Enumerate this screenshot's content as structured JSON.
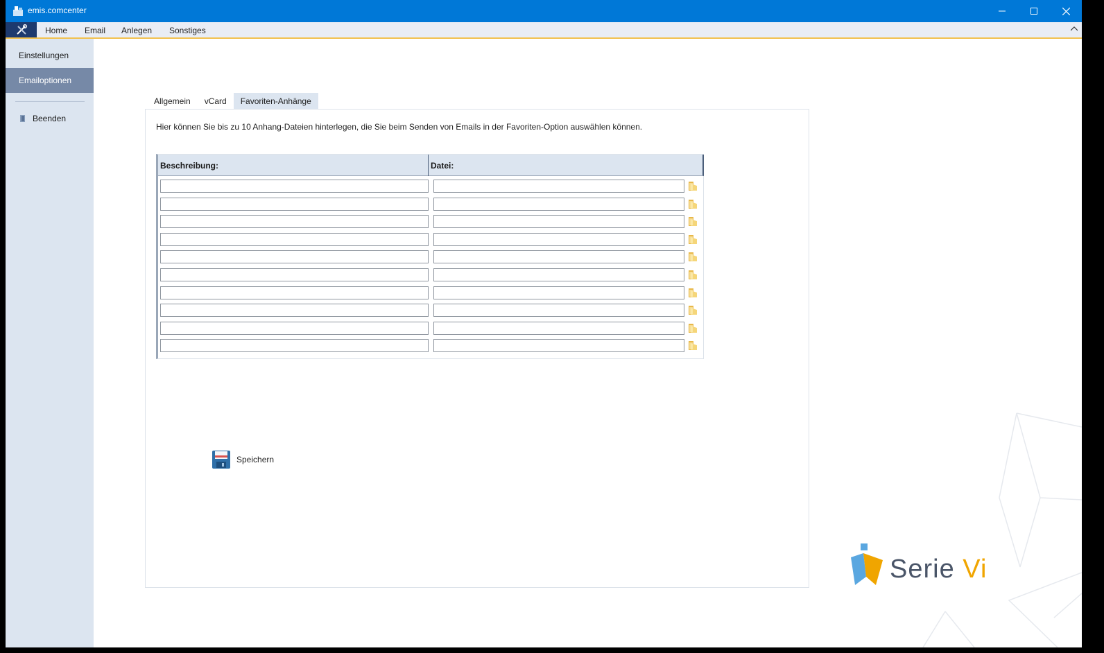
{
  "window": {
    "title": "emis.comcenter"
  },
  "ribbon": {
    "menu": [
      "Home",
      "Email",
      "Anlegen",
      "Sonstiges"
    ]
  },
  "sidebar": {
    "items": [
      {
        "label": "Einstellungen",
        "active": false
      },
      {
        "label": "Emailoptionen",
        "active": true
      }
    ],
    "exit_label": "Beenden"
  },
  "tabs": [
    {
      "label": "Allgemein",
      "active": false
    },
    {
      "label": "vCard",
      "active": false
    },
    {
      "label": "Favoriten-Anhänge",
      "active": true
    }
  ],
  "panel": {
    "intro": "Hier können Sie bis zu 10 Anhang-Dateien hinterlegen, die Sie beim Senden von Emails in der Favoriten-Option auswählen können.",
    "columns": {
      "description": "Beschreibung:",
      "file": "Datei:"
    },
    "rows": [
      {
        "description": "",
        "file": ""
      },
      {
        "description": "",
        "file": ""
      },
      {
        "description": "",
        "file": ""
      },
      {
        "description": "",
        "file": ""
      },
      {
        "description": "",
        "file": ""
      },
      {
        "description": "",
        "file": ""
      },
      {
        "description": "",
        "file": ""
      },
      {
        "description": "",
        "file": ""
      },
      {
        "description": "",
        "file": ""
      },
      {
        "description": "",
        "file": ""
      }
    ],
    "save_label": "Speichern"
  },
  "branding": {
    "logo_text": "Serie",
    "logo_accent": "Vi"
  },
  "colors": {
    "titlebar": "#0078d7",
    "sidebar_active": "#7689a7",
    "accent": "#f0a500"
  }
}
